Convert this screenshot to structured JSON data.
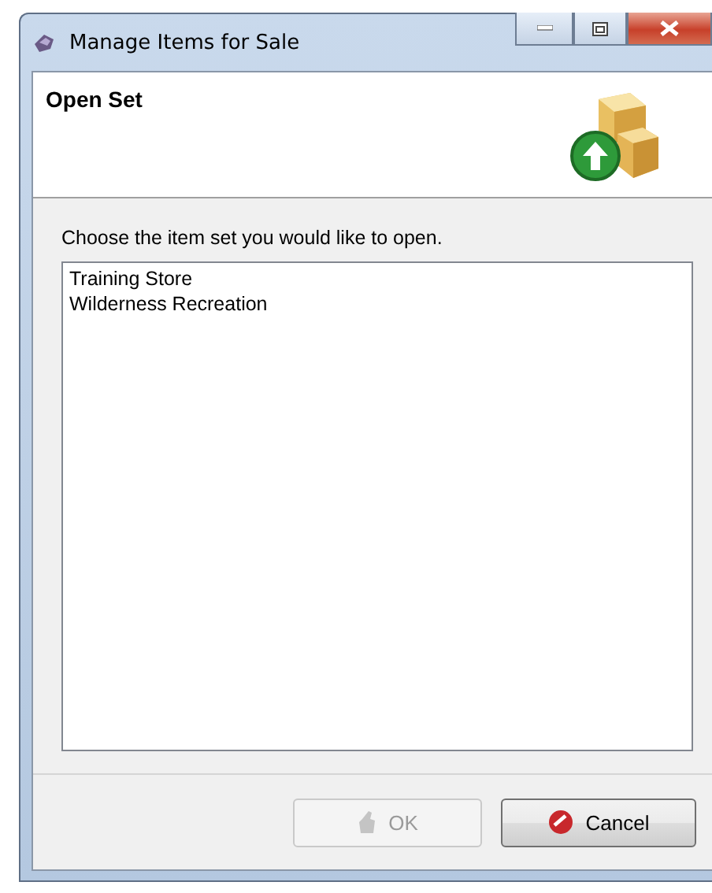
{
  "window": {
    "title": "Manage Items for Sale"
  },
  "header": {
    "title": "Open Set"
  },
  "prompt": "Choose the item set you would like to open.",
  "items": [
    {
      "label": "Training Store",
      "selected": false
    },
    {
      "label": "Wilderness Recreation",
      "selected": false
    }
  ],
  "buttons": [
    {
      "kind": "ok",
      "label": "OK",
      "disabled": true
    },
    {
      "kind": "cancel",
      "label": "Cancel",
      "disabled": false
    }
  ]
}
